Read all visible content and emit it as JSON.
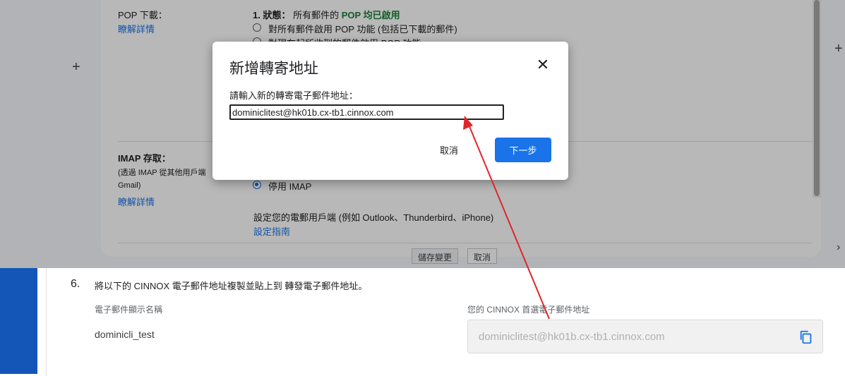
{
  "gmail": {
    "pop": {
      "heading": "POP 下載：",
      "learn_more": "瞭解詳情",
      "status_prefix": "1. 狀態：",
      "status_text": "所有郵件的",
      "status_highlight": "POP 均已啟用",
      "option1": "對所有郵件啟用 POP 功能 (包括已下載的郵件)",
      "option2": "對現在起所收到的郵件啟用 POP 功能"
    },
    "imap": {
      "heading": "IMAP 存取：",
      "desc_line1": "(透過 IMAP 從其他用戶端",
      "desc_line2": "Gmail)",
      "learn_more": "瞭解詳情",
      "disable_option": "停用 IMAP",
      "client_text": "設定您的電郵用戶端 (例如 Outlook、Thunderbird、iPhone)",
      "setup_guide": "設定指南"
    },
    "buttons": {
      "save": "儲存變更",
      "cancel": "取消"
    },
    "plus_icon": "+",
    "chevron_icon": "›"
  },
  "modal": {
    "title": "新增轉寄地址",
    "close_icon": "✕",
    "prompt": "請輸入新的轉寄電子郵件地址：",
    "input_value": "dominiclitest@hk01b.cx-tb1.cinnox.com",
    "cancel_label": "取消",
    "next_label": "下一步"
  },
  "cinnox": {
    "step_number": "6.",
    "step_text": "將以下的 CINNOX 電子郵件地址複製並貼上到 轉發電子郵件地址。",
    "name_label": "電子郵件顯示名稱",
    "name_value": "dominicli_test",
    "email_label": "您的 CINNOX 首選電子郵件地址",
    "email_value": "dominiclitest@hk01b.cx-tb1.cinnox.com",
    "copy_icon": "copy-icon"
  },
  "colors": {
    "accent_blue": "#1a73e8",
    "sidebar_blue": "#1456b8",
    "pop_green": "#188038",
    "arrow_red": "#e0262b"
  }
}
